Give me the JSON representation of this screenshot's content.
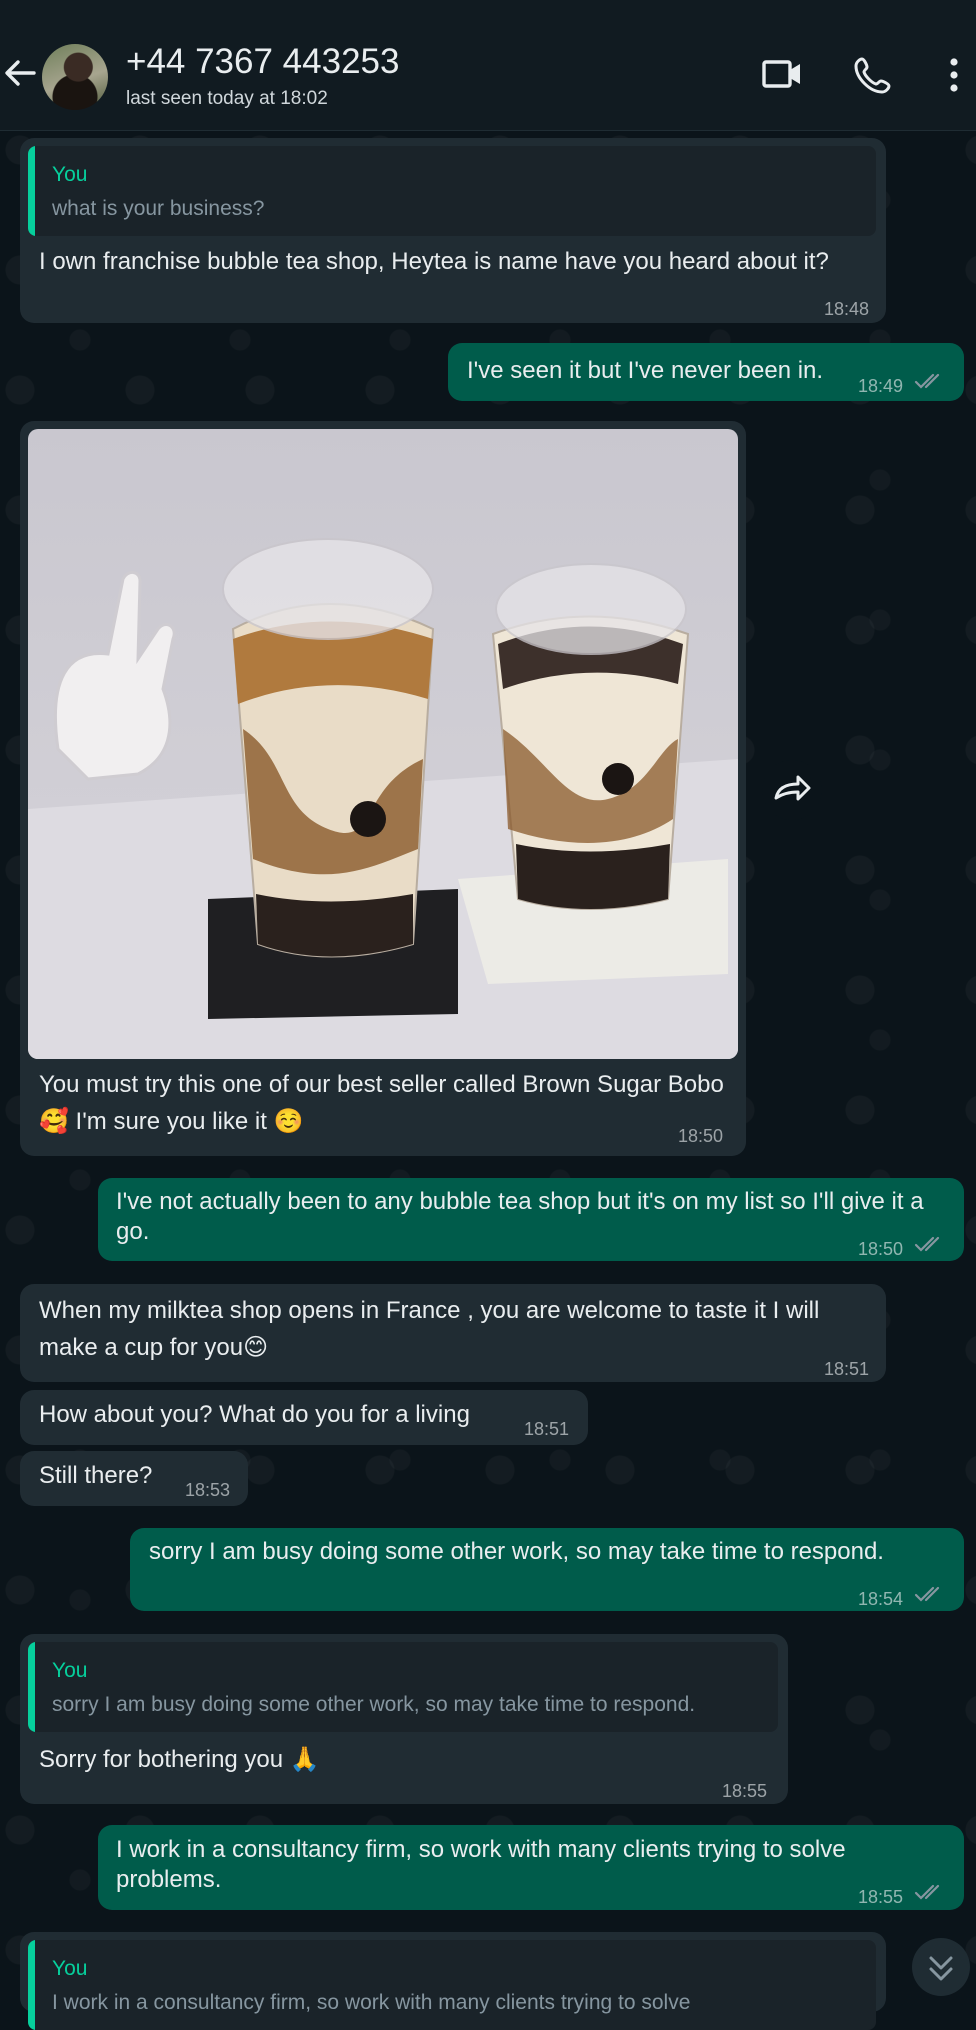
{
  "header": {
    "contact_name": "+44 7367 443253",
    "last_seen": "last seen today at 18:02",
    "icons": [
      "back-arrow-icon",
      "video-call-icon",
      "voice-call-icon",
      "more-options-icon"
    ]
  },
  "messages": [
    {
      "direction": "in",
      "quote_author": "You",
      "quote_text": "what is your business?",
      "text": "I own franchise bubble tea shop, Heytea is name have you heard about it?",
      "time": "18:48"
    },
    {
      "direction": "out",
      "text": "I've seen it but I've never been in.",
      "time": "18:49",
      "status": "read"
    },
    {
      "direction": "in",
      "image": "bubble-tea-photo",
      "text": "You must try this one of our best seller called Brown Sugar Bobo🥰 I'm sure you like it ☺️",
      "time": "18:50"
    },
    {
      "direction": "out",
      "text": "I've not actually been to any bubble tea shop but it's on my list so I'll give it a go.",
      "time": "18:50",
      "status": "read"
    },
    {
      "direction": "in",
      "text": "When my milktea shop opens in France , you are welcome to taste it I will make a cup for you😊",
      "time": "18:51"
    },
    {
      "direction": "in",
      "text": "How about you? What do you for a living",
      "time": "18:51"
    },
    {
      "direction": "in",
      "text": "Still there?",
      "time": "18:53"
    },
    {
      "direction": "out",
      "text": "sorry I am busy doing some other work, so may take time to respond.",
      "time": "18:54",
      "status": "read"
    },
    {
      "direction": "in",
      "quote_author": "You",
      "quote_text": "sorry I am busy doing some other work, so may take time to respond.",
      "text": "Sorry for bothering you 🙏",
      "time": "18:55"
    },
    {
      "direction": "out",
      "text": "I work in a consultancy firm, so work with many clients trying to solve problems.",
      "time": "18:55",
      "status": "read"
    },
    {
      "direction": "in",
      "quote_author": "You",
      "quote_text": "I work in a consultancy firm, so work with many clients trying to solve"
    }
  ],
  "colors": {
    "incoming_bubble": "#202c33",
    "outgoing_bubble": "#005c4b",
    "quote_accent": "#06cf9c",
    "read_ticks": "#8696a0"
  }
}
